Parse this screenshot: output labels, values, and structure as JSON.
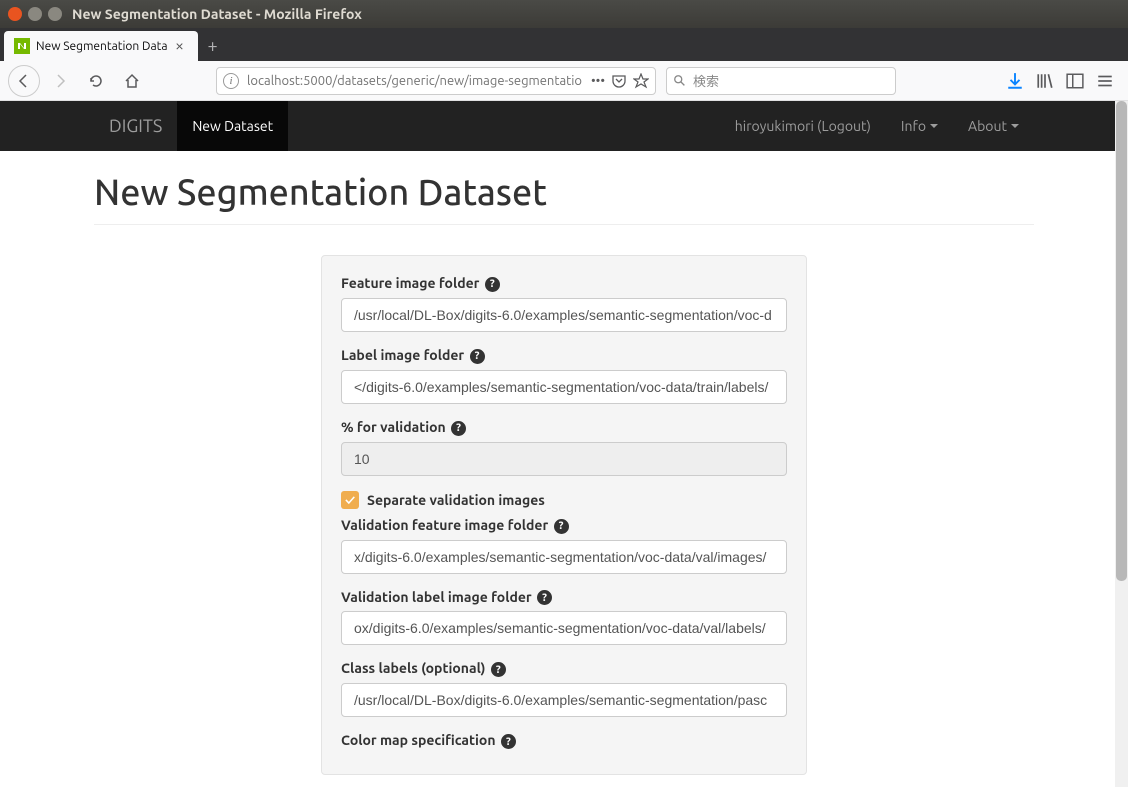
{
  "os": {
    "title": "New Segmentation Dataset - Mozilla Firefox"
  },
  "browser": {
    "tab": {
      "title": "New Segmentation Data"
    },
    "url": "localhost:5000/datasets/generic/new/image-segmentatio",
    "search_placeholder": "検索"
  },
  "nav": {
    "brand": "DIGITS",
    "active": "New Dataset",
    "user": "hiroyukimori (Logout)",
    "info": "Info",
    "about": "About"
  },
  "page": {
    "title": "New Segmentation Dataset"
  },
  "form": {
    "feature_folder": {
      "label": "Feature image folder",
      "value": "/usr/local/DL-Box/digits-6.0/examples/semantic-segmentation/voc-d"
    },
    "label_folder": {
      "label": "Label image folder",
      "value": "</digits-6.0/examples/semantic-segmentation/voc-data/train/labels/"
    },
    "pct_val": {
      "label": "% for validation",
      "value": "10"
    },
    "separate_val": {
      "label": "Separate validation images",
      "checked": true
    },
    "val_feature": {
      "label": "Validation feature image folder",
      "value": "x/digits-6.0/examples/semantic-segmentation/voc-data/val/images/"
    },
    "val_label": {
      "label": "Validation label image folder",
      "value": "ox/digits-6.0/examples/semantic-segmentation/voc-data/val/labels/"
    },
    "class_labels": {
      "label": "Class labels (optional)",
      "value": "/usr/local/DL-Box/digits-6.0/examples/semantic-segmentation/pasc"
    },
    "colormap": {
      "label": "Color map specification"
    }
  }
}
